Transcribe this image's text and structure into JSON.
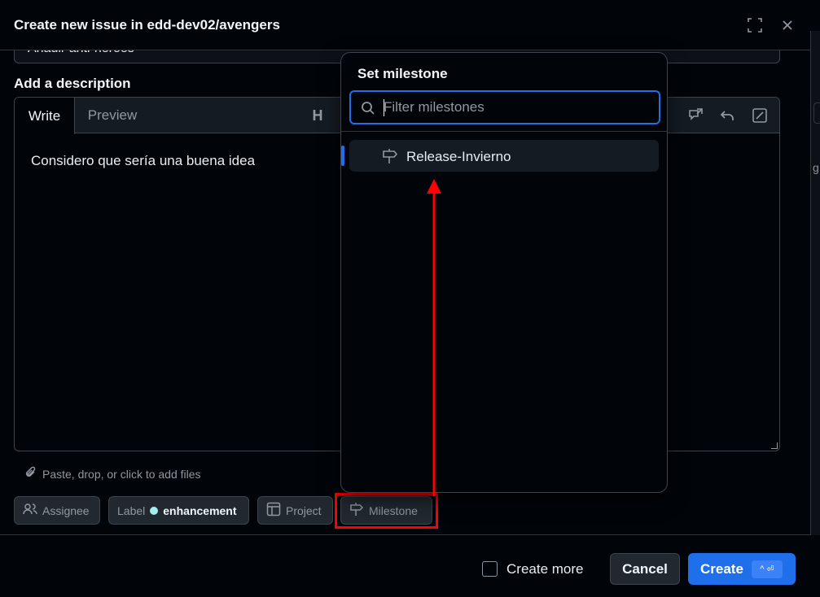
{
  "dialog": {
    "title": "Create new issue in edd-dev02/avengers",
    "issue_title_value": "Añadir anti-heroes",
    "description_label": "Add a description",
    "tabs": {
      "write": "Write",
      "preview": "Preview"
    },
    "toolbar_heading": "H",
    "description_text": "Considero que sería una buena idea",
    "attach_hint": "Paste, drop, or click to add files"
  },
  "metadata_buttons": {
    "assignee": "Assignee",
    "label_prefix": "Label",
    "label_value": "enhancement",
    "label_color": "#a2eeef",
    "project": "Project",
    "milestone": "Milestone"
  },
  "milestone_popover": {
    "title": "Set milestone",
    "search_placeholder": "Filter milestones",
    "items": [
      {
        "label": "Release-Invierno"
      }
    ]
  },
  "footer": {
    "create_more": "Create more",
    "cancel": "Cancel",
    "create": "Create",
    "create_shortcut": "^ ⏎"
  },
  "page_edge_text": "g",
  "colors": {
    "accent": "#1f6feb",
    "annotation": "#ff0000"
  }
}
